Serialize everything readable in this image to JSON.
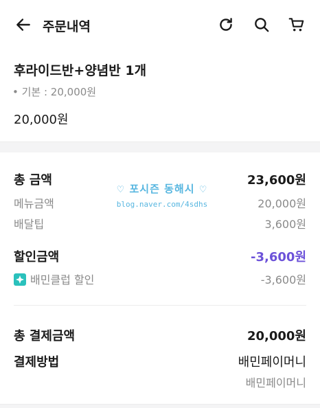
{
  "header": {
    "title": "주문내역",
    "icons": {
      "back": "arrow-left-icon",
      "refresh": "refresh-icon",
      "search": "search-icon",
      "cart": "cart-icon"
    }
  },
  "item": {
    "name": "후라이드반+양념반 1개",
    "option": "• 기본 : 20,000원",
    "price": "20,000원"
  },
  "summary": {
    "total_label": "총 금액",
    "total_value": "23,600원",
    "menu_label": "메뉴금액",
    "menu_value": "20,000원",
    "delivery_label": "배달팁",
    "delivery_value": "3,600원",
    "discount_label": "할인금액",
    "discount_value": "-3,600원",
    "club_label": "배민클럽 할인",
    "club_value": "-3,600원",
    "pay_total_label": "총 결제금액",
    "pay_total_value": "20,000원",
    "method_label": "결제방법",
    "method_value": "배민페이머니",
    "method_sub": "배민페이머니"
  },
  "watermark": {
    "title": "포시즌 동해시",
    "url": "blog.naver.com/4sdhs"
  },
  "colors": {
    "discount": "#6c52d9",
    "watermark": "#57b6e0",
    "club_icon": "#2ac1bc"
  }
}
